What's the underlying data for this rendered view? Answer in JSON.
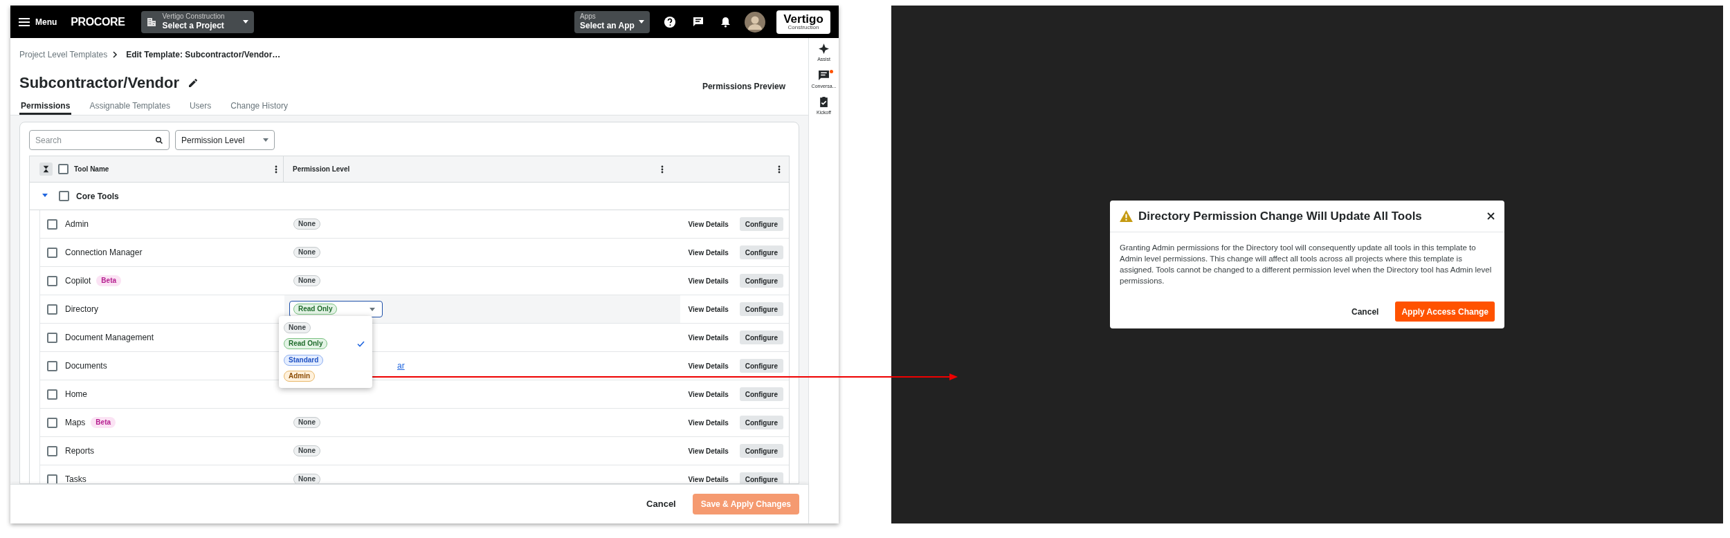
{
  "header": {
    "menu": "Menu",
    "logo": "PROCORE",
    "company": "Vertigo Construction",
    "project": "Select a Project",
    "apps_label": "Apps",
    "apps_value": "Select an App",
    "brand": "Vertigo",
    "brand_sub": "Construction"
  },
  "breadcrumb": [
    "Project Level Templates",
    "Edit Template: Subcontractor/Vendor…"
  ],
  "title": "Subcontractor/Vendor",
  "preview": "Permissions Preview",
  "tabs": [
    {
      "label": "Permissions",
      "selected": true
    },
    {
      "label": "Assignable Templates",
      "selected": false
    },
    {
      "label": "Users",
      "selected": false
    },
    {
      "label": "Change History",
      "selected": false
    }
  ],
  "search": {
    "placeholder": "Search"
  },
  "filter": "Permission Level",
  "columns": [
    "Tool Name",
    "Permission Level"
  ],
  "select_all_checked": false,
  "group": {
    "label": "Core Tools",
    "expanded": true,
    "checked": false
  },
  "rows": [
    {
      "name": "Admin",
      "checked": false,
      "level": {
        "label": "None",
        "kind": "none"
      },
      "view": "View Details",
      "configure": "Configure"
    },
    {
      "name": "Connection Manager",
      "checked": false,
      "level": {
        "label": "None",
        "kind": "none"
      },
      "view": "View Details",
      "configure": "Configure"
    },
    {
      "name": "Copilot",
      "checked": false,
      "tag": "Beta",
      "level": {
        "label": "None",
        "kind": "none"
      },
      "view": "View Details",
      "configure": "Configure"
    },
    {
      "name": "Directory",
      "checked": false,
      "dropdown": {
        "label": "Read Only",
        "kind": "read"
      },
      "highlighted": true,
      "view": "View Details",
      "configure": "Configure"
    },
    {
      "name": "Document Management",
      "checked": false,
      "view": "View Details",
      "configure": "Configure"
    },
    {
      "name": "Documents",
      "checked": false,
      "link": "ar",
      "view": "View Details",
      "configure": "Configure"
    },
    {
      "name": "Home",
      "checked": false,
      "view": "View Details",
      "configure": "Configure"
    },
    {
      "name": "Maps",
      "checked": false,
      "tag": "Beta",
      "level": {
        "label": "None",
        "kind": "none"
      },
      "view": "View Details",
      "configure": "Configure"
    },
    {
      "name": "Reports",
      "checked": false,
      "level": {
        "label": "None",
        "kind": "none"
      },
      "view": "View Details",
      "configure": "Configure"
    },
    {
      "name": "Tasks",
      "checked": false,
      "level": {
        "label": "None",
        "kind": "none"
      },
      "view": "View Details",
      "configure": "Configure"
    }
  ],
  "menu_options": [
    {
      "label": "None",
      "kind": "none",
      "selected": false
    },
    {
      "label": "Read Only",
      "kind": "read",
      "selected": true
    },
    {
      "label": "Standard",
      "kind": "standard",
      "selected": false
    },
    {
      "label": "Admin",
      "kind": "admin",
      "selected": false
    }
  ],
  "footer": {
    "cancel": "Cancel",
    "save": "Save & Apply Changes",
    "save_disabled": true
  },
  "sidebar": [
    {
      "label": "Assist",
      "kind": "assist",
      "dot": false
    },
    {
      "label": "Conversa...",
      "kind": "chat",
      "dot": true
    },
    {
      "label": "Kickoff",
      "kind": "clipboard",
      "dot": false
    }
  ],
  "modal": {
    "title": "Directory Permission Change Will Update All Tools",
    "body": "Granting Admin permissions for the Directory tool will consequently update all tools in this template to Admin level permissions. This change will affect all tools across all projects where this template is assigned. Tools cannot be changed to a different permission level when the Directory tool has Admin level permissions.",
    "cancel": "Cancel",
    "apply": "Apply Access Change"
  }
}
